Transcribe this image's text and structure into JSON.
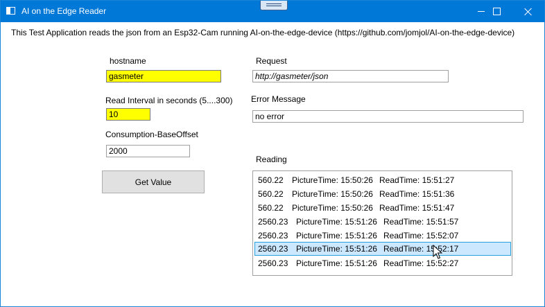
{
  "window": {
    "title": "AI on the Edge Reader"
  },
  "description": "This Test Application reads the json from an Esp32-Cam running AI-on-the-edge-device  (https://github.com/jomjol/AI-on-the-edge-device)",
  "form": {
    "hostname_label": "hostname",
    "hostname_value": "gasmeter",
    "interval_label": "Read Interval in seconds (5....300)",
    "interval_value": "10",
    "offset_label": "Consumption-BaseOffset",
    "offset_value": "2000",
    "get_value_label": "Get Value",
    "request_label": "Request",
    "request_value": "http://gasmeter/json",
    "error_label": "Error Message",
    "error_value": "no error",
    "reading_label": "Reading"
  },
  "readings": [
    {
      "value": "560.22",
      "picture": "PictureTime: 15:50:26",
      "read": "ReadTime: 15:51:27"
    },
    {
      "value": "560.22",
      "picture": "PictureTime: 15:50:26",
      "read": "ReadTime: 15:51:36"
    },
    {
      "value": "560.22",
      "picture": "PictureTime: 15:50:26",
      "read": "ReadTime: 15:51:47"
    },
    {
      "value": "2560.23",
      "picture": "PictureTime: 15:51:26",
      "read": "ReadTime: 15:51:57"
    },
    {
      "value": "2560.23",
      "picture": "PictureTime: 15:51:26",
      "read": "ReadTime: 15:52:07"
    },
    {
      "value": "2560.23",
      "picture": "PictureTime: 15:51:26",
      "read": "ReadTime: 15:52:17"
    },
    {
      "value": "2560.23",
      "picture": "PictureTime: 15:51:26",
      "read": "ReadTime: 15:52:27"
    }
  ],
  "selected_index": 5,
  "icons": {
    "app": "window-app-icon",
    "minimize": "minimize-icon",
    "maximize": "maximize-icon",
    "close": "close-icon",
    "cursor": "mouse-pointer-icon"
  },
  "colors": {
    "titlebar": "#0078d7",
    "highlight": "#ffff00",
    "selection": "#cce8ff",
    "selection_border": "#26a0da"
  }
}
